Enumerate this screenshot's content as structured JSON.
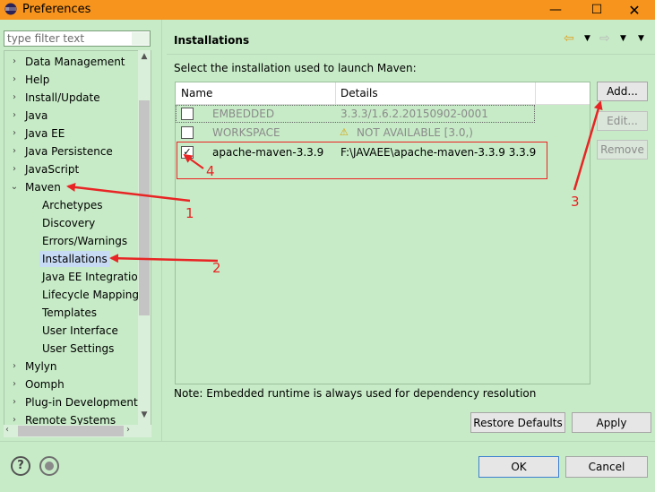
{
  "window": {
    "title": "Preferences",
    "minimize": "—",
    "maximize": "☐",
    "close": "✕"
  },
  "filter": {
    "placeholder": "type filter text"
  },
  "tree": {
    "items": [
      {
        "label": "Data Management",
        "twisty": "›"
      },
      {
        "label": "Help",
        "twisty": "›"
      },
      {
        "label": "Install/Update",
        "twisty": "›"
      },
      {
        "label": "Java",
        "twisty": "›"
      },
      {
        "label": "Java EE",
        "twisty": "›"
      },
      {
        "label": "Java Persistence",
        "twisty": "›"
      },
      {
        "label": "JavaScript",
        "twisty": "›"
      },
      {
        "label": "Maven",
        "twisty": "⌄"
      },
      {
        "label": "Archetypes"
      },
      {
        "label": "Discovery"
      },
      {
        "label": "Errors/Warnings"
      },
      {
        "label": "Installations"
      },
      {
        "label": "Java EE Integration"
      },
      {
        "label": "Lifecycle Mapping"
      },
      {
        "label": "Templates"
      },
      {
        "label": "User Interface"
      },
      {
        "label": "User Settings"
      },
      {
        "label": "Mylyn",
        "twisty": "›"
      },
      {
        "label": "Oomph",
        "twisty": "›"
      },
      {
        "label": "Plug-in Development",
        "twisty": "›"
      },
      {
        "label": "Remote Systems",
        "twisty": "›"
      }
    ]
  },
  "page": {
    "title": "Installations",
    "instruction": "Select the installation used to launch Maven:",
    "note": "Note: Embedded runtime is always used for dependency resolution"
  },
  "table": {
    "columns": [
      "Name",
      "Details"
    ],
    "rows": [
      {
        "checked": false,
        "name": "EMBEDDED",
        "details": "3.3.3/1.6.2.20150902-0001"
      },
      {
        "checked": false,
        "name": "WORKSPACE",
        "details": "NOT AVAILABLE [3.0,)"
      },
      {
        "checked": true,
        "name": "apache-maven-3.3.9",
        "details": "F:\\JAVAEE\\apache-maven-3.3.9 3.3.9"
      }
    ]
  },
  "buttons": {
    "add": "Add...",
    "edit": "Edit...",
    "remove": "Remove",
    "restore_defaults": "Restore Defaults",
    "apply": "Apply",
    "ok": "OK",
    "cancel": "Cancel"
  },
  "annotations": [
    "1",
    "2",
    "3",
    "4"
  ],
  "icons": {
    "app": "eclipse-icon",
    "warning": "warning-icon",
    "back": "back-arrow-icon",
    "forward": "forward-arrow-icon",
    "help": "help-icon",
    "record": "record-macro-icon"
  },
  "colors": {
    "title_bar": "#f7941d",
    "background": "#c7ebc7",
    "annotation": "#e82424"
  }
}
